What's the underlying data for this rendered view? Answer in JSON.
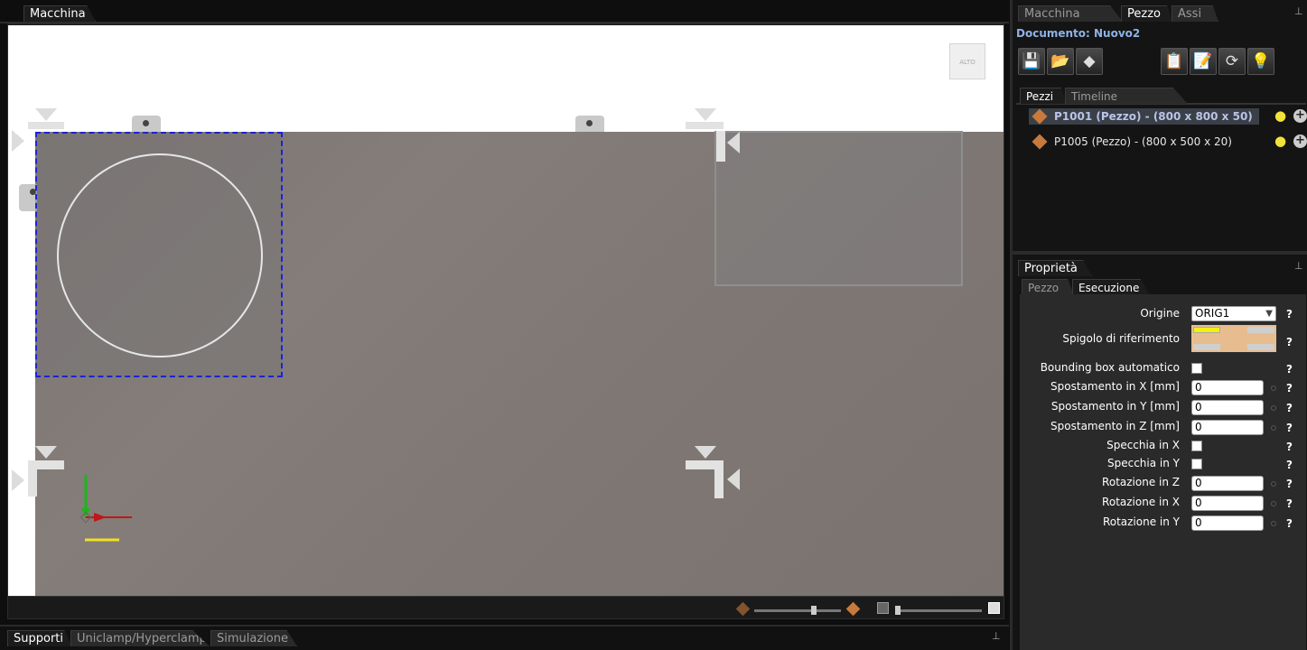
{
  "left": {
    "tab": "Macchina",
    "alto_label": "ALTO"
  },
  "bottom_tabs": [
    "Supporti",
    "Uniclamp/Hyperclamp",
    "Simulazione"
  ],
  "right": {
    "top_tabs": [
      "Macchina attiva",
      "Pezzo",
      "Assi"
    ],
    "documento": "Documento: Nuovo2",
    "toolbar_left": [
      "save-icon",
      "open-folder-icon",
      "eraser-icon"
    ],
    "toolbar_right": [
      "edit-list-icon",
      "notepad-icon",
      "refresh-icon",
      "lightbulb-icon"
    ],
    "sub_tabs": [
      "Pezzi",
      "Timeline lavorazioni"
    ],
    "pieces": [
      {
        "label": "P1001 (Pezzo) - (800 x 800 x 50)",
        "selected": true
      },
      {
        "label": "P1005 (Pezzo) - (800 x 500 x 20)",
        "selected": false
      }
    ],
    "props_title": "Proprietà",
    "props_tabs": [
      "Pezzo",
      "Esecuzione"
    ],
    "props": {
      "origine_label": "Origine",
      "origine_value": "ORIG1",
      "spigolo_label": "Spigolo di riferimento",
      "bbox_label": "Bounding box automatico",
      "sx_label": "Spostamento in X [mm]",
      "sx_value": "0",
      "sy_label": "Spostamento in Y [mm]",
      "sy_value": "0",
      "sz_label": "Spostamento in Z [mm]",
      "sz_value": "0",
      "mx_label": "Specchia in X",
      "my_label": "Specchia in Y",
      "rz_label": "Rotazione in Z",
      "rz_value": "0",
      "rx_label": "Rotazione in X",
      "rx_value": "0",
      "ry_label": "Rotazione in Y",
      "ry_value": "0",
      "help": "?"
    }
  },
  "colors": {
    "piece_diamond": "#c87a3c",
    "selection_border": "#1b22d8",
    "table": "#807874"
  }
}
